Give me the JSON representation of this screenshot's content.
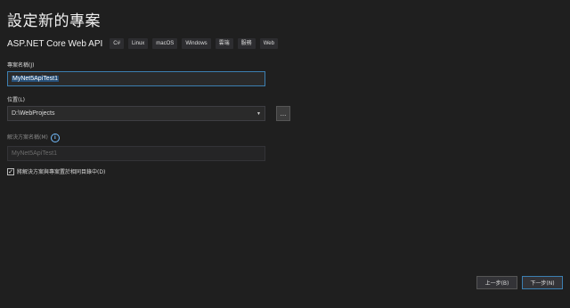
{
  "title": "設定新的專案",
  "template": {
    "name": "ASP.NET Core Web API",
    "tags": [
      "C#",
      "Linux",
      "macOS",
      "Windows",
      "雲端",
      "服務",
      "Web"
    ]
  },
  "project_name": {
    "label": "專案名稱(J)",
    "value": "MyNet5ApiTest1"
  },
  "location": {
    "label": "位置(L)",
    "value": "D:\\WebProjects",
    "browse_label": "..."
  },
  "solution_name": {
    "label": "解決方案名稱(M)",
    "info_icon": "info-icon",
    "placeholder": "MyNet5ApiTest1"
  },
  "same_dir": {
    "label": "將解決方案與專案置於相同目錄中(D)",
    "checked": true,
    "check_glyph": "✓"
  },
  "footer": {
    "back_label": "上一步(B)",
    "next_label": "下一步(N)"
  }
}
